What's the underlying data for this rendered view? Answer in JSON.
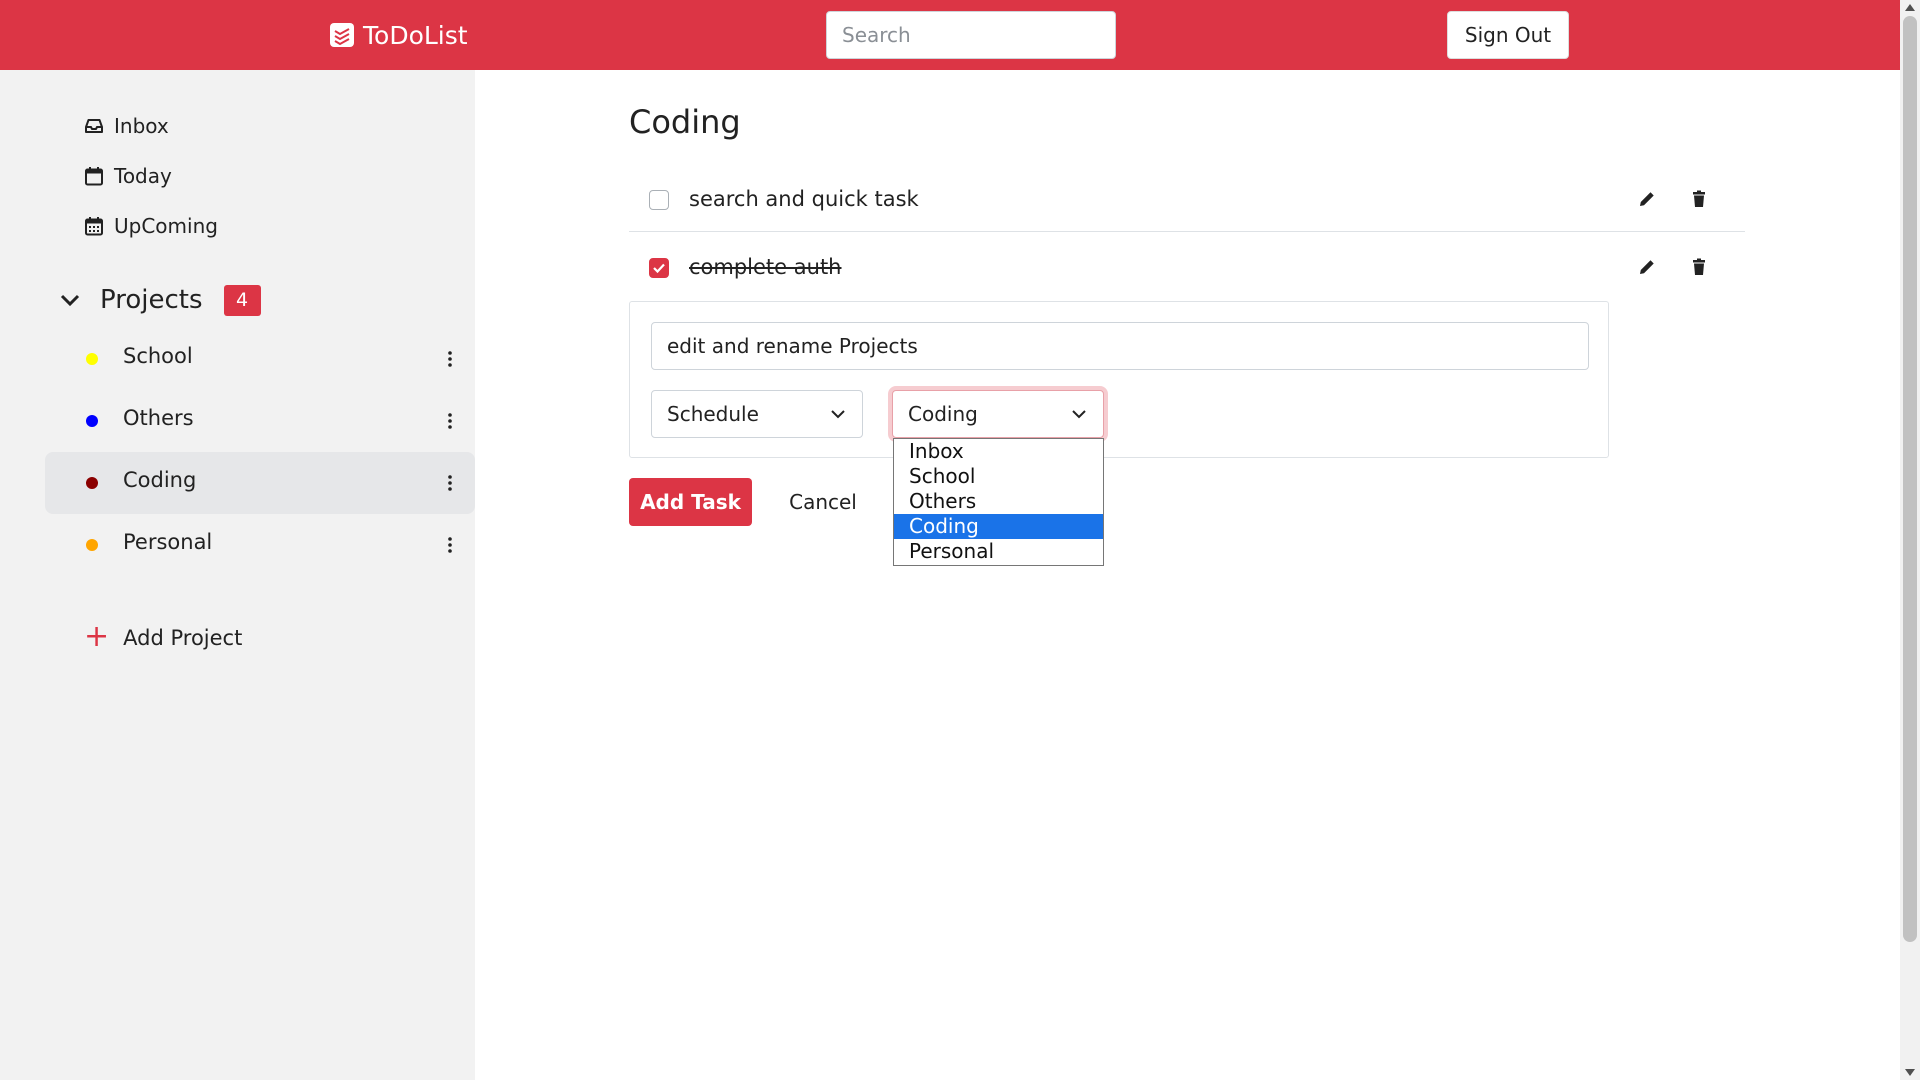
{
  "header": {
    "brand": "ToDoList",
    "search_placeholder": "Search",
    "sign_out": "Sign Out",
    "bar_color": "#dc3545"
  },
  "sidebar": {
    "nav": [
      {
        "label": "Inbox",
        "icon": "inbox-icon"
      },
      {
        "label": "Today",
        "icon": "calendar-icon"
      },
      {
        "label": "UpComing",
        "icon": "calendar-week-icon"
      }
    ],
    "projects_title": "Projects",
    "projects_count": "4",
    "projects": [
      {
        "name": "School",
        "color": "#ffff00",
        "active": false
      },
      {
        "name": "Others",
        "color": "#0000ff",
        "active": false
      },
      {
        "name": "Coding",
        "color": "#8b0000",
        "active": true
      },
      {
        "name": "Personal",
        "color": "#ffa500",
        "active": false
      }
    ],
    "add_project": "Add Project"
  },
  "main": {
    "title": "Coding",
    "tasks": [
      {
        "name": "search and quick task",
        "done": false
      },
      {
        "name": "complete auth",
        "done": true
      }
    ],
    "form": {
      "task_value": "edit and rename Projects",
      "schedule_label": "Schedule",
      "project_selected": "Coding",
      "project_options": [
        "Inbox",
        "School",
        "Others",
        "Coding",
        "Personal"
      ],
      "add_button": "Add Task",
      "cancel_button": "Cancel"
    }
  }
}
